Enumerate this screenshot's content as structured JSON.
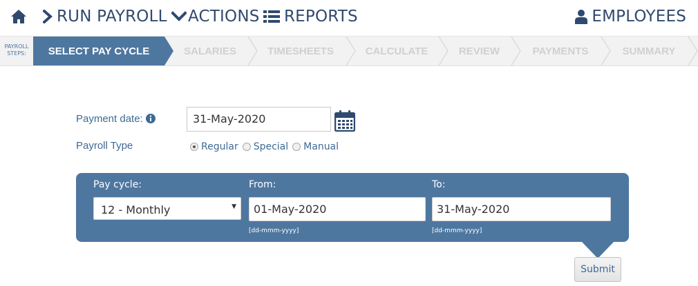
{
  "nav": {
    "home_icon": "home-icon",
    "run_payroll": "RUN PAYROLL",
    "actions": "ACTIONS",
    "reports": "REPORTS",
    "employees": "EMPLOYEES"
  },
  "steps": {
    "caption_line1": "PAYROLL",
    "caption_line2": "STEPS:",
    "items": [
      {
        "label": "SELECT PAY CYCLE",
        "active": true
      },
      {
        "label": "SALARIES",
        "active": false
      },
      {
        "label": "TIMESHEETS",
        "active": false
      },
      {
        "label": "CALCULATE",
        "active": false
      },
      {
        "label": "REVIEW",
        "active": false
      },
      {
        "label": "PAYMENTS",
        "active": false
      },
      {
        "label": "SUMMARY",
        "active": false
      }
    ]
  },
  "form": {
    "payment_date_label": "Payment date:",
    "payment_date_value": "31-May-2020",
    "payroll_type_label": "Payroll Type",
    "payroll_types": [
      {
        "label": "Regular",
        "selected": true
      },
      {
        "label": "Special",
        "selected": false
      },
      {
        "label": "Manual",
        "selected": false
      }
    ]
  },
  "panel": {
    "pay_cycle_label": "Pay cycle:",
    "pay_cycle_value": "12 - Monthly",
    "from_label": "From:",
    "from_value": "01-May-2020",
    "from_hint": "[dd-mmm-yyyy]",
    "to_label": "To:",
    "to_value": "31-May-2020",
    "to_hint": "[dd-mmm-yyyy]"
  },
  "submit_label": "Submit",
  "colors": {
    "nav_text": "#2f4a6e",
    "active_step": "#4e77a0",
    "panel": "#4e77a0",
    "label": "#3e6a94"
  }
}
